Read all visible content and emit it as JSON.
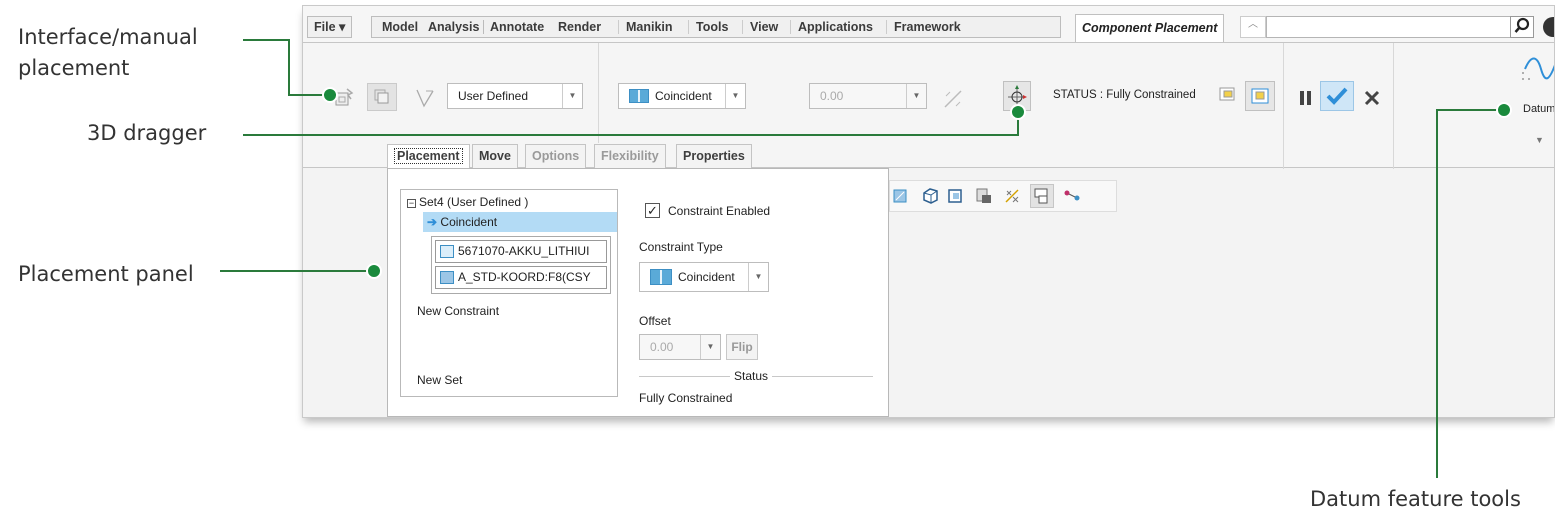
{
  "callouts": {
    "interface_line1": "Interface/manual",
    "interface_line2": "placement",
    "dragger": "3D dragger",
    "placement_panel": "Placement panel",
    "datum_tools": "Datum feature tools"
  },
  "menu": {
    "file": "File",
    "tabs": [
      "Model",
      "Analysis",
      "Annotate",
      "Render",
      "Manikin",
      "Tools",
      "View",
      "Applications",
      "Framework"
    ],
    "active_tab": "Component Placement"
  },
  "ribbon": {
    "placement_type": "User Defined",
    "constraint": "Coincident",
    "offset": "0.00",
    "status": "STATUS : Fully Constrained",
    "datum_label": "Datum"
  },
  "subtabs": [
    "Placement",
    "Move",
    "Options",
    "Flexibility",
    "Properties"
  ],
  "panel": {
    "set_label": "Set4 (User Defined )",
    "selected_constraint": "Coincident",
    "ref1": "5671070-AKKU_LITHIUI",
    "ref2": "A_STD-KOORD:F8(CSY",
    "new_constraint": "New Constraint",
    "new_set": "New Set",
    "constraint_enabled": "Constraint Enabled",
    "constraint_type_label": "Constraint Type",
    "constraint_type": "Coincident",
    "offset_label": "Offset",
    "offset_value": "0.00",
    "flip": "Flip",
    "status_heading": "Status",
    "status_value": "Fully Constrained"
  },
  "colors": {
    "callout_green": "#1a8a3c",
    "callout_line": "#2a7a3b",
    "selection_blue": "#b3dbf5",
    "check_blue": "#2f8fd8"
  }
}
